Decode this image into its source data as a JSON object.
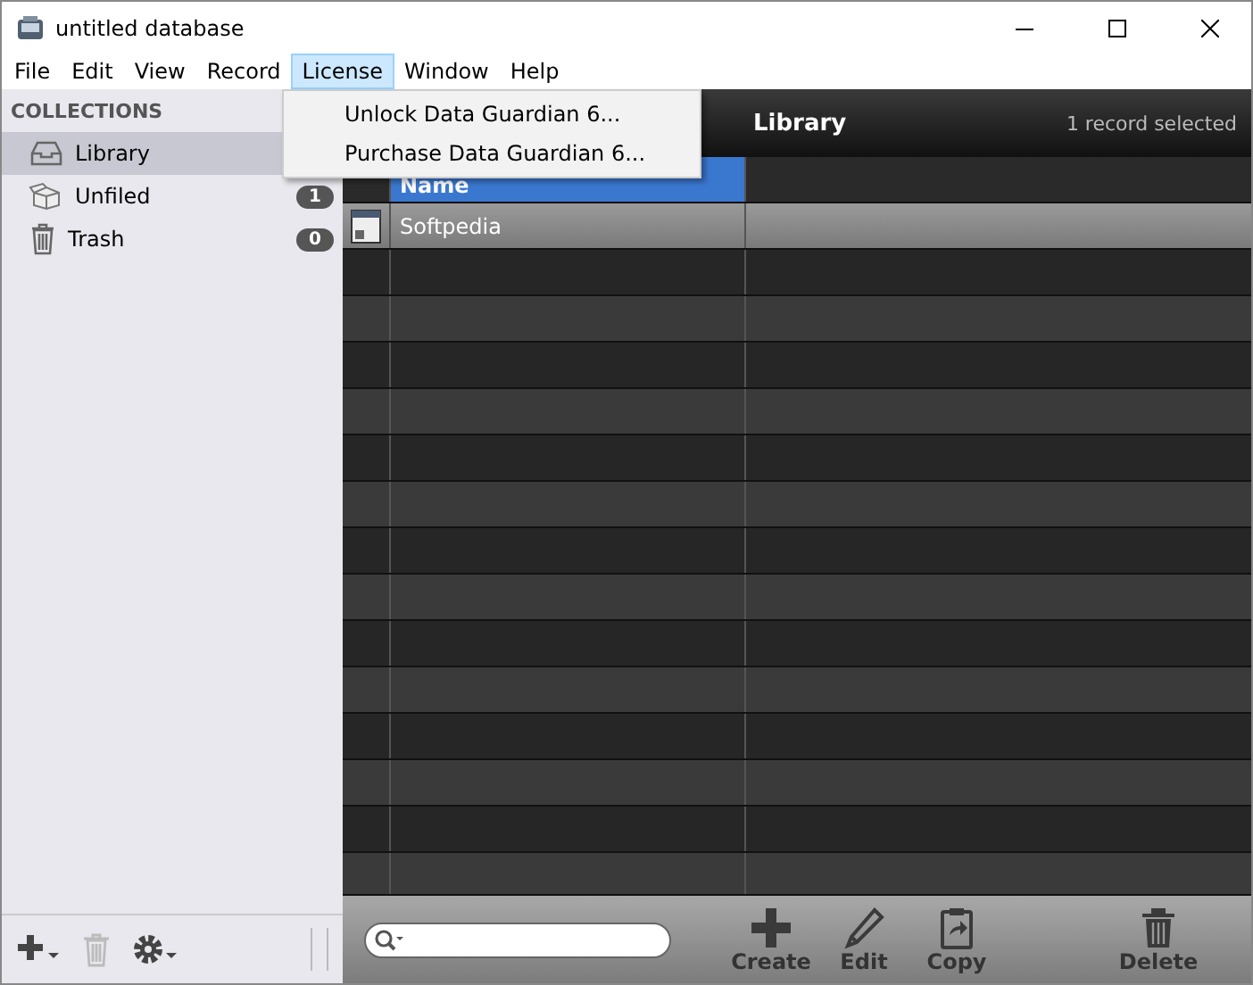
{
  "window": {
    "title": "untitled database"
  },
  "menu": [
    {
      "label": "File",
      "selected": false
    },
    {
      "label": "Edit",
      "selected": false
    },
    {
      "label": "View",
      "selected": false
    },
    {
      "label": "Record",
      "selected": false
    },
    {
      "label": "License",
      "selected": true
    },
    {
      "label": "Window",
      "selected": false
    },
    {
      "label": "Help",
      "selected": false
    }
  ],
  "open_menu": {
    "items": [
      "Unlock Data Guardian 6...",
      "Purchase Data Guardian 6..."
    ]
  },
  "sidebar": {
    "heading": "COLLECTIONS",
    "items": [
      {
        "label": "Library",
        "kind": "inbox",
        "selected": true
      },
      {
        "label": "Unfiled",
        "kind": "box",
        "badge": "1",
        "selected": false
      },
      {
        "label": "Trash",
        "kind": "trash",
        "badge": "0",
        "selected": false
      }
    ],
    "tools": [
      {
        "kind": "add",
        "disabled": false
      },
      {
        "kind": "trash",
        "disabled": true
      },
      {
        "kind": "gear",
        "disabled": false
      }
    ]
  },
  "view": {
    "title": "Library",
    "status": "1 record selected"
  },
  "table": {
    "columns": [
      {
        "label": "Name",
        "selected": true
      }
    ],
    "rows": [
      {
        "name": "Softpedia",
        "selected": true
      }
    ]
  },
  "toolbar": {
    "buttons": [
      {
        "kind": "create",
        "label": "Create"
      },
      {
        "kind": "edit",
        "label": "Edit"
      },
      {
        "kind": "copy",
        "label": "Copy"
      },
      {
        "kind": "delete",
        "label": "Delete"
      }
    ]
  }
}
